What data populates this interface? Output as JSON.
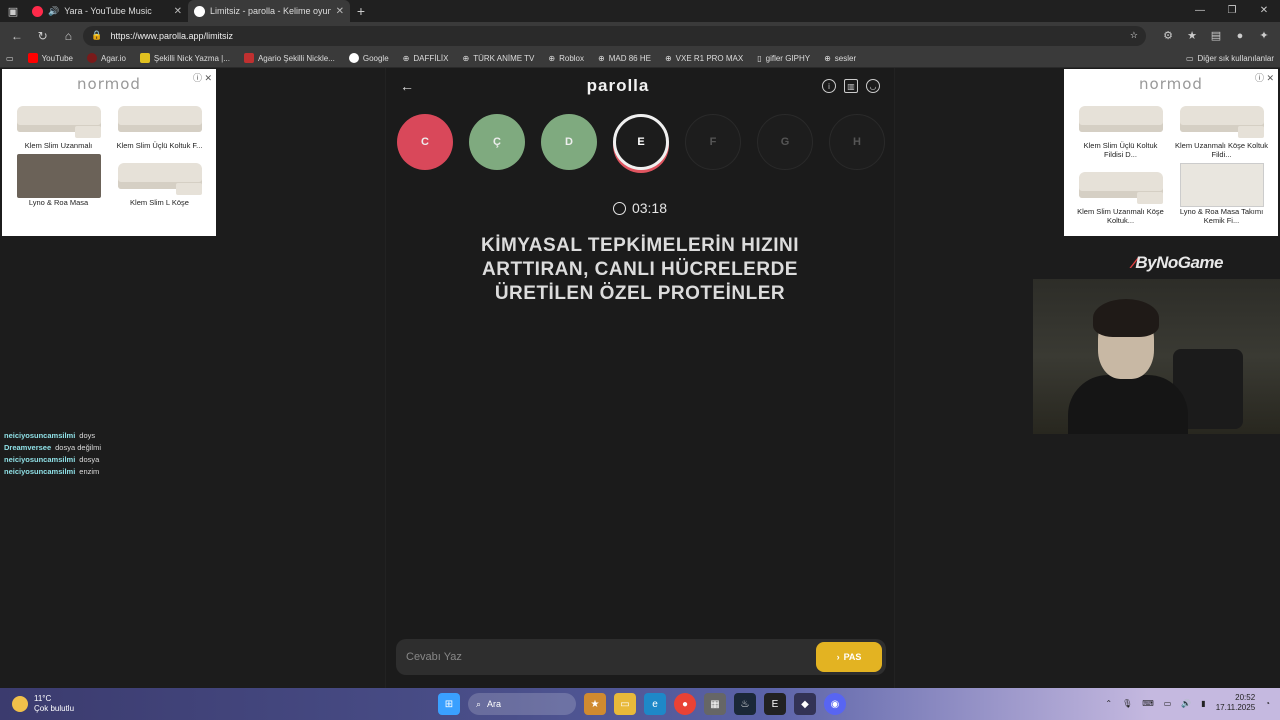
{
  "browser": {
    "tabs": [
      {
        "title": "Yara - YouTube Music",
        "favicon_color": "#ff2a4a",
        "active": false
      },
      {
        "title": "Limitsiz - parolla - Kelime oyunu",
        "favicon_color": "#ffffff",
        "active": true
      }
    ],
    "url": "https://www.parolla.app/limitsiz",
    "bookmarks": [
      {
        "label": "YouTube",
        "color": "#ff0000"
      },
      {
        "label": "Agar.io",
        "color": "#7a1a1a"
      },
      {
        "label": "Şekilli Nick Yazma |...",
        "color": "#e0c020"
      },
      {
        "label": "Agario Şekilli Nickle...",
        "color": "#c03030"
      },
      {
        "label": "Google",
        "color": "#ffffff"
      },
      {
        "label": "DAFFİLİX",
        "color": "#888888"
      },
      {
        "label": "TÜRK ANİME TV",
        "color": "#888888"
      },
      {
        "label": "Roblox",
        "color": "#888888"
      },
      {
        "label": "MAD 86 HE",
        "color": "#888888"
      },
      {
        "label": "VXE R1 PRO MAX",
        "color": "#888888"
      },
      {
        "label": "gifler GIPHY",
        "color": "#dddddd"
      },
      {
        "label": "sesler",
        "color": "#888888"
      }
    ],
    "bookmarks_other": "Diğer sık kullanılanlar"
  },
  "ads": {
    "brand": "normod",
    "left": [
      {
        "label": "Klem Slim Uzanmalı",
        "img": "sofa-l"
      },
      {
        "label": "Klem Slim Üçlü Koltuk F...",
        "img": "sofa"
      },
      {
        "label": "Lyno & Roa Masa",
        "img": "table"
      },
      {
        "label": "Klem Slim L Köşe",
        "img": "sofa-l"
      }
    ],
    "right": [
      {
        "label": "Klem Slim Üçlü Koltuk Fildisi D...",
        "img": "sofa"
      },
      {
        "label": "Klem Uzanmalı Köşe Koltuk Fildi...",
        "img": "sofa-l"
      },
      {
        "label": "Klem Slim Uzanmalı Köşe Koltuk...",
        "img": "sofa-l"
      },
      {
        "label": "Lyno & Roa Masa Takımı Kemik Fi...",
        "img": "tableW"
      }
    ]
  },
  "game": {
    "logo": "parolla",
    "letters": [
      {
        "char": "C",
        "state": "wrong"
      },
      {
        "char": "Ç",
        "state": "correct"
      },
      {
        "char": "D",
        "state": "correct"
      },
      {
        "char": "E",
        "state": "current"
      },
      {
        "char": "F",
        "state": "pending"
      },
      {
        "char": "G",
        "state": "pending"
      },
      {
        "char": "H",
        "state": "pending"
      }
    ],
    "timer": "03:18",
    "question": "KİMYASAL TEPKİMELERİN HIZINI ARTTIRAN, CANLI HÜCRELERDE ÜRETİLEN ÖZEL PROTEİNLER",
    "answer_placeholder": "Cevabı Yaz",
    "pass_label": "PAS"
  },
  "chat": [
    {
      "user": "neiciyosuncamsilmi",
      "msg": "doys"
    },
    {
      "user": "Dreamversee",
      "msg": "dosya değilmi"
    },
    {
      "user": "neiciyosuncamsilmi",
      "msg": "dosya"
    },
    {
      "user": "neiciyosuncamsilmi",
      "msg": "enzim"
    }
  ],
  "stream_brand": "ByNoGame",
  "taskbar": {
    "weather_temp": "11°C",
    "weather_desc": "Çok bulutlu",
    "search_label": "Ara",
    "time": "20:52",
    "date": "17.11.2025"
  }
}
